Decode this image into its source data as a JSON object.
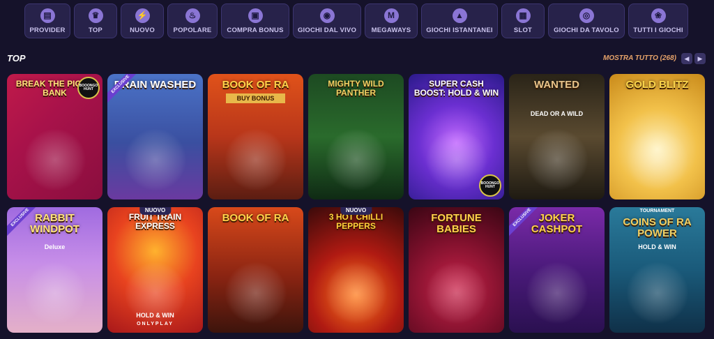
{
  "categories": [
    {
      "label": "PROVIDER",
      "icon": "book-icon",
      "glyph": "▤",
      "w": 66
    },
    {
      "label": "TOP",
      "icon": "crown-icon",
      "glyph": "♛",
      "w": 62
    },
    {
      "label": "NUOVO",
      "icon": "lightning-icon",
      "glyph": "⚡",
      "w": 62
    },
    {
      "label": "POPOLARE",
      "icon": "flame-icon",
      "glyph": "♨",
      "w": 72
    },
    {
      "label": "COMPRA BONUS",
      "icon": "gift-icon",
      "glyph": "▣",
      "w": 98
    },
    {
      "label": "GIOCHI DAL VIVO",
      "icon": "chip-icon",
      "glyph": "◉",
      "w": 98
    },
    {
      "label": "MEGAWAYS",
      "icon": "megaways-icon",
      "glyph": "M",
      "w": 76
    },
    {
      "label": "GIOCHI ISTANTANEI",
      "icon": "rocket-icon",
      "glyph": "▲",
      "w": 110
    },
    {
      "label": "SLOT",
      "icon": "slot-machine-icon",
      "glyph": "▦",
      "w": 62
    },
    {
      "label": "GIOCHI DA TAVOLO",
      "icon": "roulette-icon",
      "glyph": "◎",
      "w": 110
    },
    {
      "label": "TUTTI I GIOCHI",
      "icon": "cherries-icon",
      "glyph": "❀",
      "w": 86
    }
  ],
  "section": {
    "title": "TOP",
    "show_all": "MOSTRA TUTTO (268)"
  },
  "games": [
    {
      "title": "BREAK the PIGGY BANK",
      "sub": "",
      "name": "game-break-the-piggy-bank",
      "bg": "linear-gradient(135deg,#c01a4a 0%,#a8124a 40%,#8a0e3e 100%)",
      "color": "#ffe27a",
      "provider_badge": "BOOONGO HUNT",
      "new": false,
      "exclusive": false
    },
    {
      "title": "BRAIN WASHED",
      "sub": "",
      "name": "game-brain-washed",
      "bg": "linear-gradient(180deg,#4b73c7 0%,#3a4fa0 55%,#6a3aa0 100%)",
      "color": "#ffffff",
      "new": false,
      "exclusive": true
    },
    {
      "title": "BOOK OF RA",
      "sub": "BUY BONUS",
      "name": "game-book-of-ra-buy-bonus",
      "bg": "linear-gradient(180deg,#e0521a 0%,#b8361a 50%,#5b1d12 100%)",
      "color": "#ffd24a",
      "new": false,
      "exclusive": false
    },
    {
      "title": "MIGHTY WILD PANTHER",
      "sub": "",
      "name": "game-mighty-wild-panther",
      "bg": "linear-gradient(180deg,#1d4a22 0%,#2a6b2c 50%,#0f2a14 100%)",
      "color": "#f2d063",
      "new": false,
      "exclusive": false
    },
    {
      "title": "SUPER CASH BOOST: HOLD & WIN",
      "sub": "",
      "name": "game-super-cash-boost",
      "bg": "radial-gradient(circle at 50% 55%,#c46cff 0%,#6b2fd1 45%,#2b1a8a 100%)",
      "color": "#ffffff",
      "provider_badge": "BOOONGO HUNT",
      "new": false,
      "exclusive": false
    },
    {
      "title": "WANTED",
      "sub": "DEAD OR A WILD",
      "name": "game-wanted-dead-or-a-wild",
      "bg": "linear-gradient(180deg,#2a2418 0%,#5a4a30 50%,#1e1a12 100%)",
      "color": "#e9c48a",
      "new": false,
      "exclusive": false
    },
    {
      "title": "GOLD BLITZ",
      "sub": "",
      "name": "game-gold-blitz",
      "bg": "radial-gradient(circle at 50% 60%,#fff3c2 0%,#f2c14a 45%,#c98a1a 100%)",
      "color": "#f7d24a",
      "new": false,
      "exclusive": false
    },
    {
      "title": "RABBIT WINDPOT",
      "sub": "Deluxe",
      "name": "game-rabbit-windpot-deluxe",
      "bg": "linear-gradient(180deg,#a06be0 0%,#c78ee8 45%,#e4b0c8 100%)",
      "color": "#ffe27a",
      "new": false,
      "exclusive": true
    },
    {
      "title": "FRUIT TRAIN EXPRESS",
      "sub": "HOLD & WIN",
      "name": "game-fruit-train-express",
      "bg": "radial-gradient(circle at 50% 35%,#ffb22e 0%,#e8431f 45%,#a8181a 100%)",
      "color": "#ffffff",
      "footer": "ONLYPLAY",
      "new": true,
      "exclusive": false
    },
    {
      "title": "BOOK OF RA",
      "sub": "",
      "name": "game-book-of-ra",
      "bg": "linear-gradient(180deg,#d8491a 0%,#8a2412 55%,#3d140c 100%)",
      "color": "#ffd24a",
      "new": false,
      "exclusive": false
    },
    {
      "title": "3 HOT CHILLI PEPPERS",
      "sub": "",
      "name": "game-3-hot-chilli-peppers",
      "bg": "radial-gradient(circle at 50% 70%,#ff7a1a 0%,#b01a12 45%,#3a0a0a 100%)",
      "color": "#ffd23a",
      "new": true,
      "exclusive": false
    },
    {
      "title": "FORTUNE BABIES",
      "sub": "",
      "name": "game-fortune-babies",
      "bg": "radial-gradient(circle at 50% 65%,#c9234a 0%,#7a0f2a 55%,#3a0614 100%)",
      "color": "#ffd24a",
      "new": false,
      "exclusive": false
    },
    {
      "title": "JOKER CASHPOT",
      "sub": "",
      "name": "game-joker-cashpot",
      "bg": "linear-gradient(180deg,#7a2aa8 0%,#4a1a7a 50%,#2a1050 100%)",
      "color": "#ffd24a",
      "new": false,
      "exclusive": true
    },
    {
      "title": "COINS OF RA POWER",
      "sub": "HOLD & WIN",
      "name": "game-coins-of-ra-power",
      "bg": "linear-gradient(180deg,#2a7a9a 0%,#1a5a7a 50%,#0f3048 100%)",
      "color": "#f2d063",
      "top_label": "TOURNAMENT",
      "new": false,
      "exclusive": false
    }
  ],
  "labels": {
    "new": "NUOVO",
    "exclusive": "EXCLUSIVE"
  }
}
